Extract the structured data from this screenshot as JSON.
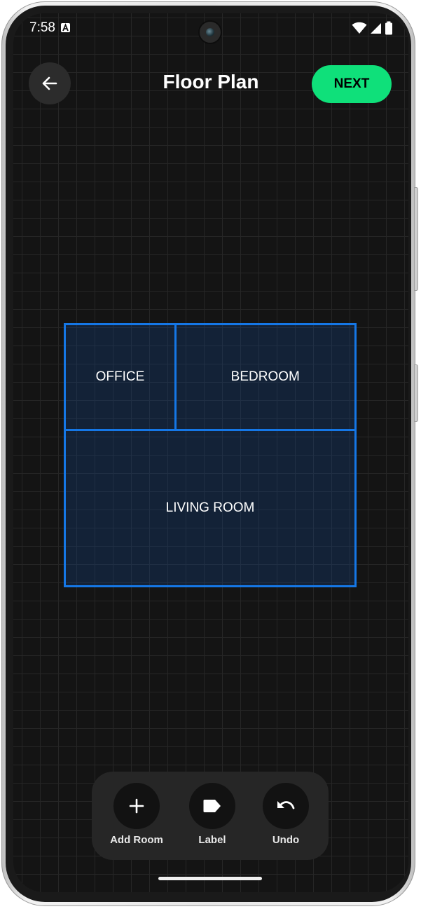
{
  "status_bar": {
    "time": "7:58",
    "icons": [
      "text-a-icon",
      "wifi-icon",
      "signal-icon",
      "battery-icon"
    ]
  },
  "header": {
    "title": "Floor Plan",
    "back_icon": "arrow-left-icon",
    "next_label": "NEXT"
  },
  "floor_plan": {
    "rooms": [
      {
        "label": "OFFICE"
      },
      {
        "label": "BEDROOM"
      },
      {
        "label": "LIVING ROOM"
      }
    ]
  },
  "toolbar": {
    "items": [
      {
        "label": "Add Room",
        "icon": "plus-icon"
      },
      {
        "label": "Label",
        "icon": "tag-icon"
      },
      {
        "label": "Undo",
        "icon": "undo-icon"
      }
    ]
  },
  "colors": {
    "background": "#141414",
    "grid_line": "#262626",
    "accent_green": "#0fe07a",
    "room_outline": "#1577e6",
    "toolbar_bg": "#262626"
  }
}
